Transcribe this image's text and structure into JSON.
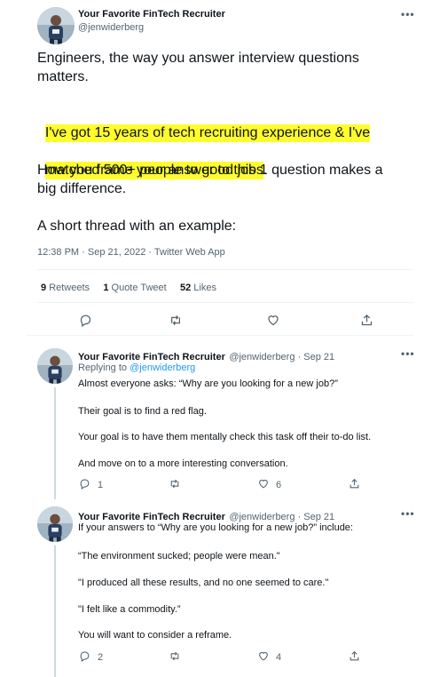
{
  "main_tweet": {
    "author_name": "Your Favorite FinTech Recruiter",
    "author_handle": "@jenwiderberg",
    "paragraph1": "Engineers, the way you answer interview questions\nmatters.",
    "highlight_line1": "I've got 15 years of tech recruiting experience & I've",
    "highlight_line2": "matched 500+ people to good jobs",
    "highlight_suffix": ".",
    "paragraph3": "How you frame your answer to this 1 question makes a\nbig difference.",
    "paragraph4": "A short thread with an example:",
    "timestamp": "12:38 PM · Sep 21, 2022 · Twitter Web App",
    "retweets_count": "9",
    "retweets_label": "Retweets",
    "quotes_count": "1",
    "quotes_label": "Quote Tweet",
    "likes_count": "52",
    "likes_label": "Likes",
    "highlight_color": "#fffc2e"
  },
  "replies": [
    {
      "author_name": "Your Favorite FinTech Recruiter",
      "author_handle": "@jenwiderberg · Sep 21",
      "replying_prefix": "Replying to",
      "replying_to": "@jenwiderberg",
      "lines": [
        "Almost everyone asks: “Why are you looking for a new job?”",
        "Their goal is to find a red flag.",
        "Your goal is to have them mentally check this task off their to-do list.",
        "And move on to a more interesting conversation."
      ],
      "reply_count": "1",
      "retweet_count": "",
      "like_count": "6"
    },
    {
      "author_name": "Your Favorite FinTech Recruiter",
      "author_handle": "@jenwiderberg · Sep 21",
      "lines": [
        "If your answers to “Why are you looking for a new job?” include:",
        "“The environment sucked; people were mean.\"",
        "\"I produced all these results, and no one seemed to care.\"",
        "\"I felt like a commodity.”",
        "You will want to consider a reframe."
      ],
      "reply_count": "2",
      "retweet_count": "",
      "like_count": "4"
    }
  ],
  "icons": {
    "more": "more-horizontal-icon",
    "reply": "reply-icon",
    "retweet": "retweet-icon",
    "like": "heart-icon",
    "share": "share-icon"
  },
  "more_glyph": "•••",
  "colors": {
    "link": "#1d9bf0",
    "muted": "#536471",
    "text": "#0f1419",
    "divider": "#eff3f4"
  }
}
